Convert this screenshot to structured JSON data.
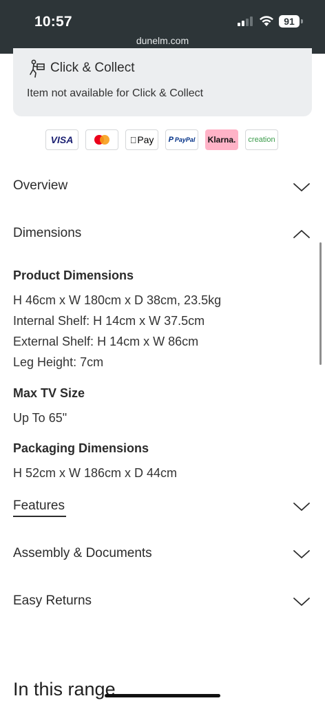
{
  "status_bar": {
    "time": "10:57",
    "battery": "91",
    "url": "dunelm.com"
  },
  "click_collect": {
    "title": "Click & Collect",
    "note": "Item not available for Click & Collect",
    "icon": "person-carrying-box-icon"
  },
  "payments": [
    {
      "name": "visa",
      "label": "VISA"
    },
    {
      "name": "mastercard",
      "label": ""
    },
    {
      "name": "apple-pay",
      "label": "Pay"
    },
    {
      "name": "paypal",
      "label": "PayPal"
    },
    {
      "name": "klarna",
      "label": "Klarna."
    },
    {
      "name": "creation",
      "label": "creation"
    }
  ],
  "accordion": {
    "overview": "Overview",
    "dimensions": "Dimensions",
    "features": "Features",
    "assembly": "Assembly & Documents",
    "returns": "Easy Returns"
  },
  "dimensions": {
    "product_heading": "Product Dimensions",
    "product_lines": [
      "H 46cm x W 180cm x D 38cm, 23.5kg",
      "Internal Shelf: H 14cm x W 37.5cm",
      "External Shelf: H 14cm x W 86cm",
      "Leg Height: 7cm"
    ],
    "tv_heading": "Max TV Size",
    "tv_value": "Up To 65\"",
    "packaging_heading": "Packaging Dimensions",
    "packaging_value": "H 52cm x W 186cm x D 44cm"
  },
  "range_title": "In this range",
  "colors": {
    "status_bg": "#2d3538",
    "card_bg": "#eceef0",
    "klarna_pink": "#ffb3c7"
  }
}
